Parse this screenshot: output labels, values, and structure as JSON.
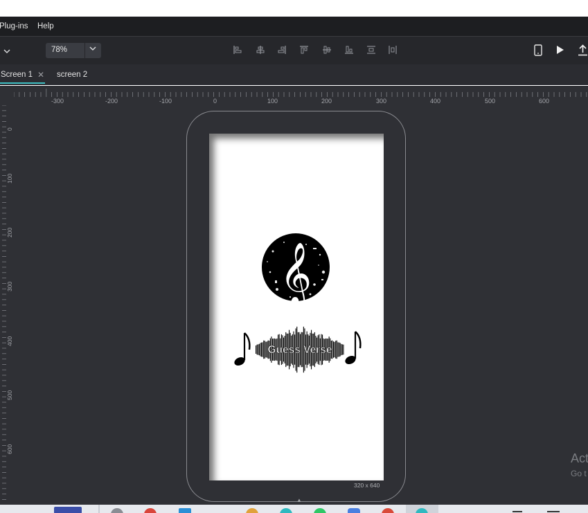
{
  "menu": {
    "plugins_label": "Plug-ins",
    "help_label": "Help"
  },
  "toolbar": {
    "dropdown_icon": "chevron-down-icon",
    "zoom_value": "78%",
    "right_icons": [
      "phone-preview-icon",
      "play-icon",
      "export-icon"
    ],
    "align_icons": [
      "align-left-icon",
      "align-center-h-icon",
      "align-right-icon",
      "align-top-icon",
      "align-center-v-icon",
      "align-bottom-icon",
      "distribute-v-icon",
      "distribute-h-icon"
    ]
  },
  "tabs": [
    {
      "label": "Screen 1",
      "active": true
    },
    {
      "label": "screen 2",
      "active": false
    }
  ],
  "ruler": {
    "horizontal": [
      "-300",
      "-200",
      "-100",
      "0",
      "100",
      "200",
      "300",
      "400",
      "500",
      "600"
    ],
    "vertical": [
      "0",
      "100",
      "200",
      "300",
      "400",
      "500",
      "600"
    ]
  },
  "artboard": {
    "size_label": "320 x 640",
    "logo_text": "Guess Verse"
  },
  "watermark": {
    "line1": "Act",
    "line2": "Go t"
  },
  "colors": {
    "accent": "#3fbfc2",
    "canvas": "#2f3035",
    "toolbar": "#26272b",
    "menubar": "#1d1e21"
  }
}
